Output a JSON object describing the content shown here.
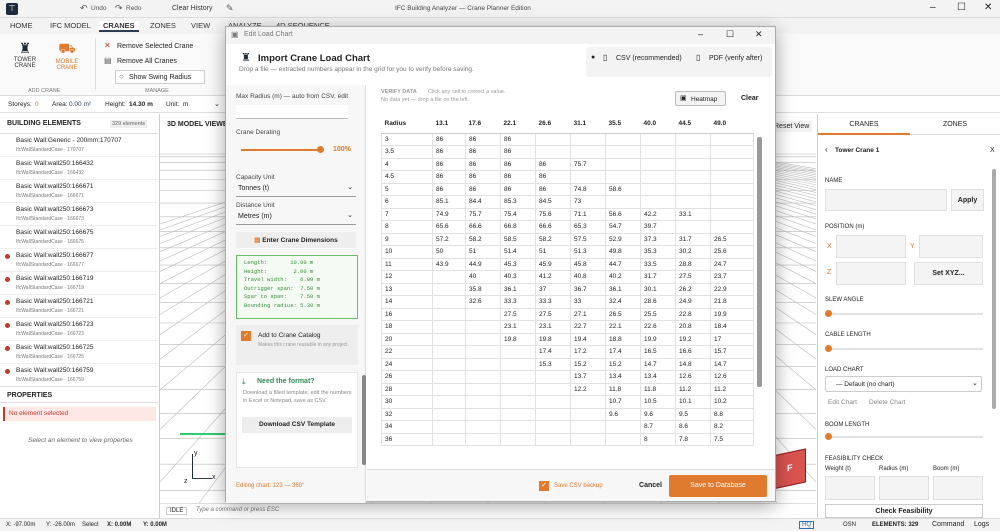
{
  "titlebar": {
    "undo": "Undo",
    "redo": "Redo",
    "clear_history": "Clear History",
    "app_title": "IFC Building Analyzer — Crane Planner Edition"
  },
  "ribbon_tabs": [
    "HOME",
    "IFC MODEL",
    "CRANES",
    "ZONES",
    "VIEW",
    "ANALYZE",
    "4D SEQUENCE"
  ],
  "ribbon": {
    "tower_crane": "TOWER\nCRANE",
    "mobile_crane": "MOBILE\nCRANE",
    "add_crane": "ADD CRANE",
    "remove_selected": "Remove Selected Crane",
    "remove_all": "Remove All Cranes",
    "show_swing": "Show Swing Radius",
    "manage": "MANAGE"
  },
  "statusline": {
    "storeys_label": "Storeys:",
    "storeys_val": "0",
    "area_label": "Area:",
    "area_val": "0.00 m²",
    "height_label": "Height:",
    "height_val": "14.30 m",
    "unit_label": "Unit:",
    "unit_val": "m"
  },
  "left": {
    "title": "BUILDING ELEMENTS",
    "count": "329 elements",
    "props_title": "PROPERTIES",
    "no_selection": "No element selected",
    "select_hint": "Select an element to view properties",
    "elements": [
      {
        "name": "Basic Wall:Generic - 200mm:170707",
        "cls": "IfcWallStandardCase · 170707",
        "dot": false
      },
      {
        "name": "Basic Wall:wall250:166432",
        "cls": "IfcWallStandardCase · 166432",
        "dot": false
      },
      {
        "name": "Basic Wall:wall250:166671",
        "cls": "IfcWallStandardCase · 166671",
        "dot": false
      },
      {
        "name": "Basic Wall:wall250:166673",
        "cls": "IfcWallStandardCase · 166673",
        "dot": false
      },
      {
        "name": "Basic Wall:wall250:166675",
        "cls": "IfcWallStandardCase · 166675",
        "dot": false
      },
      {
        "name": "Basic Wall:wall250:166677",
        "cls": "IfcWallStandardCase · 166677",
        "dot": true
      },
      {
        "name": "Basic Wall:wall250:166719",
        "cls": "IfcWallStandardCase · 166719",
        "dot": true
      },
      {
        "name": "Basic Wall:wall250:166721",
        "cls": "IfcWallStandardCase · 166721",
        "dot": true
      },
      {
        "name": "Basic Wall:wall250:166723",
        "cls": "IfcWallStandardCase · 166723",
        "dot": true
      },
      {
        "name": "Basic Wall:wall250:166725",
        "cls": "IfcWallStandardCase · 166725",
        "dot": true
      },
      {
        "name": "Basic Wall:wall250:166759",
        "cls": "IfcWallStandardCase · 166759",
        "dot": true
      }
    ]
  },
  "viewport": {
    "title": "3D MODEL VIEWER",
    "reset_view": "Reset View",
    "idle": "IDLE",
    "cmd_placeholder": "Type a command or press ESC"
  },
  "right": {
    "tab_cranes": "CRANES",
    "tab_zones": "ZONES",
    "crane_name": "Tower Crane 1",
    "close": "X",
    "name_label": "NAME",
    "apply": "Apply",
    "position_label": "POSITION (m)",
    "x": "X",
    "y": "Y",
    "z": "Z",
    "set_xyz": "Set XYZ...",
    "slew_angle": "SLEW ANGLE",
    "cable_length": "CABLE LENGTH",
    "load_chart": "LOAD CHART",
    "load_chart_val": "— Default (no chart)",
    "edit_chart": "Edit Chart",
    "delete_chart": "Delete Chart",
    "boom_length": "BOOM LENGTH",
    "feasibility": "FEASIBILITY CHECK",
    "weight": "Weight (t)",
    "radius": "Radius (m)",
    "boom": "Boom (m)",
    "check": "Check Feasibility"
  },
  "bottombar": {
    "x": "X: -97.00m",
    "y": "Y: -26.00m",
    "select": "Select",
    "x0": "X: 0.00M",
    "y0": "Y: 0.00M",
    "hq": "HQ",
    "osn": "OSN",
    "elements": "ELEMENTS: 329",
    "command": "Command",
    "logs": "Logs"
  },
  "dialog": {
    "window_title": "Edit Load Chart",
    "heading": "Import Crane Load Chart",
    "subheading": "Drop a file — extracted numbers appear in the grid for you to verify before saving.",
    "csv": "CSV (recommended)",
    "pdf": "PDF (verify after)",
    "max_radius": "Max Radius (m) — auto from CSV, edit",
    "derating": "Crane Derating",
    "derating_val": "100%",
    "capacity_unit": "Capacity Unit",
    "capacity_val": "Tonnes (t)",
    "distance_unit": "Distance Unit",
    "distance_val": "Metres (m)",
    "enter_dims": "Enter Crane Dimensions",
    "dims": [
      "Length:       10.00 m",
      "Height:        2.00 m",
      "Travel width:    6.00 m",
      "Outrigger span:  7.50 m",
      "Spar to span:    7.50 m",
      "Bounding radius: 5.30 m"
    ],
    "add_catalog": "Add to Crane Catalog",
    "add_catalog_hint": "Makes this crane reusable in any project.",
    "need_format": "Need the format?",
    "need_format_hint": "Download a filled template, edit the numbers in Excel or Notepad, save as CSV.",
    "download_csv": "Download CSV Template",
    "verify_data": "VERIFY DATA",
    "verify_hint": "Click any cell to correct a value.",
    "no_data": "No data yet — drop a file on the left.",
    "heatmap": "Heatmap",
    "clear": "Clear",
    "editing": "Editing chart: 123 — 360°",
    "save_backup": "Save CSV backup",
    "cancel": "Cancel",
    "save_db": "Save to Database",
    "table": {
      "headers": [
        "Radius",
        "13.1",
        "17.6",
        "22.1",
        "26.6",
        "31.1",
        "35.5",
        "40.0",
        "44.5",
        "49.0"
      ],
      "rows": [
        [
          "3",
          "86",
          "86",
          "86",
          "",
          "",
          "",
          "",
          "",
          ""
        ],
        [
          "3.5",
          "86",
          "86",
          "86",
          "",
          "",
          "",
          "",
          "",
          ""
        ],
        [
          "4",
          "86",
          "86",
          "86",
          "86",
          "75.7",
          "",
          "",
          "",
          ""
        ],
        [
          "4.5",
          "86",
          "86",
          "86",
          "86",
          "",
          "",
          "",
          "",
          ""
        ],
        [
          "5",
          "86",
          "86",
          "86",
          "86",
          "74.8",
          "58.6",
          "",
          "",
          ""
        ],
        [
          "6",
          "85.1",
          "84.4",
          "85.3",
          "84.5",
          "73",
          "",
          "",
          "",
          ""
        ],
        [
          "7",
          "74.9",
          "75.7",
          "75.4",
          "75.6",
          "71.1",
          "56.6",
          "42.2",
          "33.1",
          ""
        ],
        [
          "8",
          "65.6",
          "66.6",
          "66.8",
          "66.6",
          "65.3",
          "54.7",
          "39.7",
          "",
          ""
        ],
        [
          "9",
          "57.2",
          "58.2",
          "58.5",
          "58.2",
          "57.5",
          "52.9",
          "37.3",
          "31.7",
          "26.5"
        ],
        [
          "10",
          "50",
          "51",
          "51.4",
          "51",
          "51.3",
          "49.8",
          "35.3",
          "30.2",
          "25.6"
        ],
        [
          "11",
          "43.9",
          "44.9",
          "45.3",
          "45.9",
          "45.8",
          "44.7",
          "33.5",
          "28.8",
          "24.7"
        ],
        [
          "12",
          "",
          "40",
          "40.3",
          "41.2",
          "40.8",
          "40.2",
          "31.7",
          "27.5",
          "23.7"
        ],
        [
          "13",
          "",
          "35.8",
          "36.1",
          "37",
          "36.7",
          "36.1",
          "30.1",
          "26.2",
          "22.9"
        ],
        [
          "14",
          "",
          "32.6",
          "33.3",
          "33.3",
          "33",
          "32.4",
          "28.6",
          "24.9",
          "21.8"
        ],
        [
          "16",
          "",
          "",
          "27.5",
          "27.5",
          "27.1",
          "26.5",
          "25.5",
          "22.8",
          "19.9"
        ],
        [
          "18",
          "",
          "",
          "23.1",
          "23.1",
          "22.7",
          "22.1",
          "22.6",
          "20.8",
          "18.4"
        ],
        [
          "20",
          "",
          "",
          "19.8",
          "19.8",
          "19.4",
          "18.8",
          "19.9",
          "19.2",
          "17"
        ],
        [
          "22",
          "",
          "",
          "",
          "17.4",
          "17.2",
          "17.4",
          "16.5",
          "16.6",
          "15.7"
        ],
        [
          "24",
          "",
          "",
          "",
          "15.3",
          "15.2",
          "15.2",
          "14.7",
          "14.8",
          "14.7"
        ],
        [
          "26",
          "",
          "",
          "",
          "",
          "13.7",
          "13.4",
          "13.4",
          "12.6",
          "12.6"
        ],
        [
          "28",
          "",
          "",
          "",
          "",
          "12.2",
          "11.8",
          "11.8",
          "11.2",
          "11.2"
        ],
        [
          "30",
          "",
          "",
          "",
          "",
          "",
          "10.7",
          "10.5",
          "10.1",
          "10.2"
        ],
        [
          "32",
          "",
          "",
          "",
          "",
          "",
          "9.6",
          "9.6",
          "9.5",
          "8.8"
        ],
        [
          "34",
          "",
          "",
          "",
          "",
          "",
          "",
          "8.7",
          "8.6",
          "8.2"
        ],
        [
          "36",
          "",
          "",
          "",
          "",
          "",
          "",
          "8",
          "7.8",
          "7.5"
        ]
      ]
    }
  }
}
